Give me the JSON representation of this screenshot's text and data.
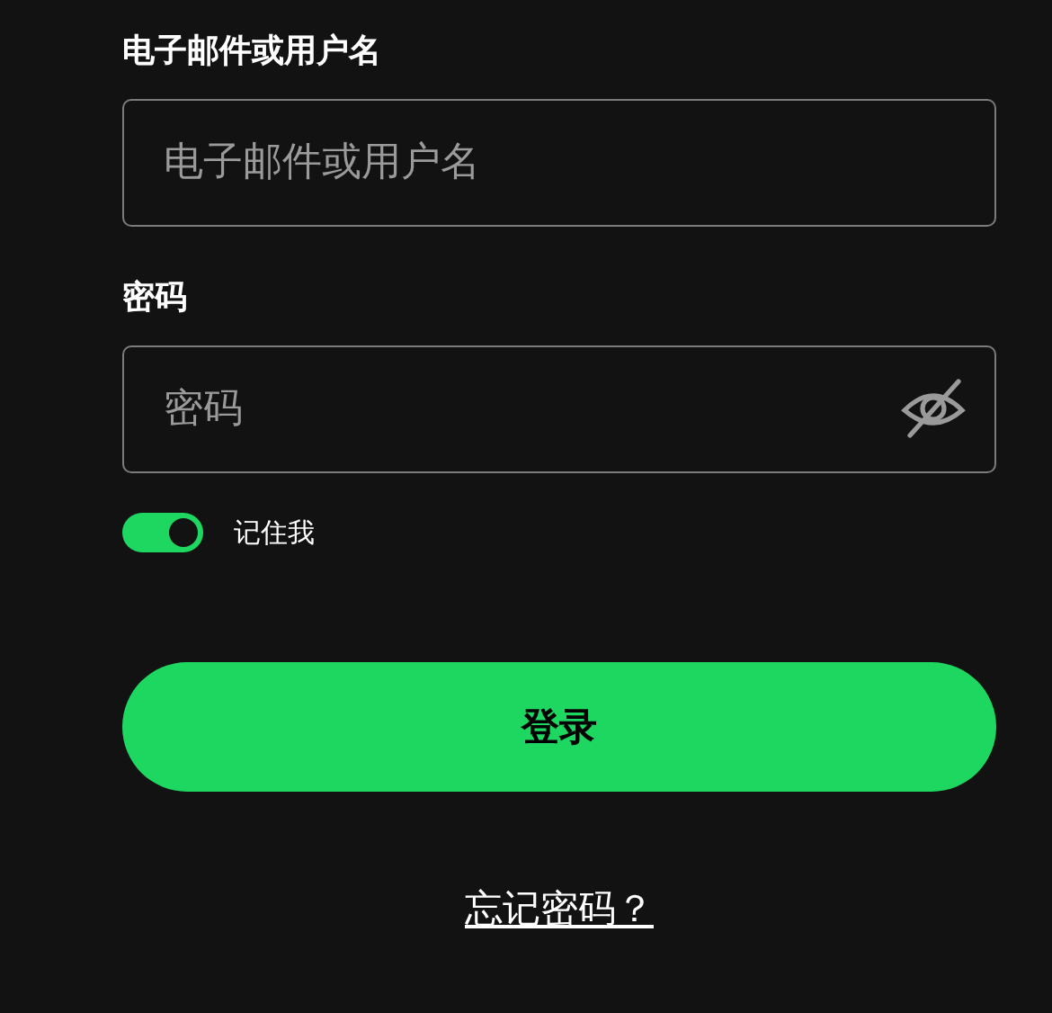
{
  "username": {
    "label": "电子邮件或用户名",
    "placeholder": "电子邮件或用户名"
  },
  "password": {
    "label": "密码",
    "placeholder": "密码",
    "visible": false
  },
  "remember": {
    "label": "记住我",
    "on": true
  },
  "login_button": "登录",
  "forgot_link": "忘记密码？"
}
